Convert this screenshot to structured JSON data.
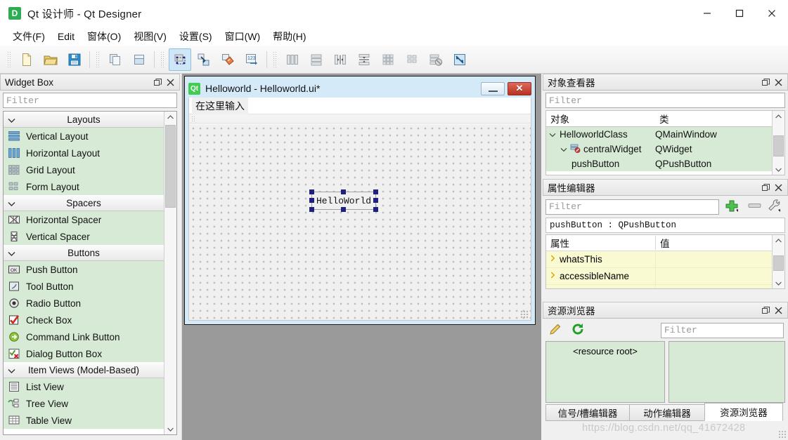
{
  "window": {
    "app_icon_letter": "D",
    "title": "Qt 设计师 - Qt Designer",
    "controls": {
      "minimize": "minimize-icon",
      "maximize": "maximize-icon",
      "close": "close-icon"
    }
  },
  "menubar": {
    "items": [
      {
        "label": "文件(F)",
        "name": "menu-file"
      },
      {
        "label": "Edit",
        "name": "menu-edit"
      },
      {
        "label": "窗体(O)",
        "name": "menu-form"
      },
      {
        "label": "视图(V)",
        "name": "menu-view"
      },
      {
        "label": "设置(S)",
        "name": "menu-settings"
      },
      {
        "label": "窗口(W)",
        "name": "menu-window"
      },
      {
        "label": "帮助(H)",
        "name": "menu-help"
      }
    ]
  },
  "toolbar": {
    "groups": [
      {
        "buttons": [
          {
            "name": "new-form-button",
            "icon": "new-file-icon",
            "active": false
          },
          {
            "name": "open-form-button",
            "icon": "open-folder-icon",
            "active": false
          },
          {
            "name": "save-form-button",
            "icon": "save-disk-icon",
            "active": false
          }
        ]
      },
      {
        "buttons": [
          {
            "name": "copy-button",
            "icon": "copy-icon",
            "active": false
          },
          {
            "name": "paste-button",
            "icon": "paste-icon",
            "active": false
          }
        ]
      },
      {
        "buttons": [
          {
            "name": "edit-widgets-button",
            "icon": "edit-widgets-icon",
            "active": true
          },
          {
            "name": "edit-signals-slots-button",
            "icon": "signals-slots-icon",
            "active": false
          },
          {
            "name": "edit-buddies-button",
            "icon": "buddies-icon",
            "active": false
          },
          {
            "name": "edit-tab-order-button",
            "icon": "tab-order-icon",
            "active": false
          }
        ]
      },
      {
        "buttons": [
          {
            "name": "layout-horizontally-button",
            "icon": "layout-horizontal-icon",
            "active": false
          },
          {
            "name": "layout-vertically-button",
            "icon": "layout-vertical-icon",
            "active": false
          },
          {
            "name": "layout-splitter-horizontal-button",
            "icon": "splitter-horizontal-icon",
            "active": false
          },
          {
            "name": "layout-splitter-vertical-button",
            "icon": "splitter-vertical-icon",
            "active": false
          },
          {
            "name": "layout-grid-button",
            "icon": "layout-grid-icon",
            "active": false
          },
          {
            "name": "layout-form-button",
            "icon": "layout-form-icon",
            "active": false
          },
          {
            "name": "break-layout-button",
            "icon": "break-layout-icon",
            "active": false
          },
          {
            "name": "adjust-size-button",
            "icon": "adjust-size-icon",
            "active": false
          }
        ]
      }
    ]
  },
  "widget_box": {
    "title": "Widget Box",
    "filter_placeholder": "Filter",
    "categories": [
      {
        "label": "Layouts",
        "expanded": true,
        "items": [
          {
            "label": "Vertical Layout",
            "icon": "vertical-layout-icon"
          },
          {
            "label": "Horizontal Layout",
            "icon": "horizontal-layout-icon"
          },
          {
            "label": "Grid Layout",
            "icon": "grid-layout-icon"
          },
          {
            "label": "Form Layout",
            "icon": "form-layout-icon"
          }
        ]
      },
      {
        "label": "Spacers",
        "expanded": true,
        "items": [
          {
            "label": "Horizontal Spacer",
            "icon": "horizontal-spacer-icon"
          },
          {
            "label": "Vertical Spacer",
            "icon": "vertical-spacer-icon"
          }
        ]
      },
      {
        "label": "Buttons",
        "expanded": true,
        "items": [
          {
            "label": "Push Button",
            "icon": "push-button-icon"
          },
          {
            "label": "Tool Button",
            "icon": "tool-button-icon"
          },
          {
            "label": "Radio Button",
            "icon": "radio-button-icon"
          },
          {
            "label": "Check Box",
            "icon": "check-box-icon"
          },
          {
            "label": "Command Link Button",
            "icon": "command-link-icon"
          },
          {
            "label": "Dialog Button Box",
            "icon": "dialog-button-box-icon"
          }
        ]
      },
      {
        "label": "Item Views (Model-Based)",
        "expanded": true,
        "items": [
          {
            "label": "List View",
            "icon": "list-view-icon"
          },
          {
            "label": "Tree View",
            "icon": "tree-view-icon"
          },
          {
            "label": "Table View",
            "icon": "table-view-icon"
          }
        ]
      }
    ]
  },
  "form_window": {
    "title": "Helloworld - Helloworld.ui*",
    "qt_icon_label": "Qt",
    "menu_placeholder": "在这里输入",
    "selected_widget_text": "HelloWorld",
    "minimize_label": "minimize-icon",
    "close_label": "close-icon"
  },
  "object_inspector": {
    "title": "对象查看器",
    "filter_placeholder": "Filter",
    "columns": [
      "对象",
      "类"
    ],
    "rows": [
      {
        "object": "HelloworldClass",
        "class": "QMainWindow",
        "depth": 0,
        "icon": "",
        "expanded": true
      },
      {
        "object": "centralWidget",
        "class": "QWidget",
        "depth": 1,
        "icon": "central-widget-icon",
        "expanded": true
      },
      {
        "object": "pushButton",
        "class": "QPushButton",
        "depth": 2,
        "icon": "push-button-icon",
        "expanded": false
      }
    ]
  },
  "property_editor": {
    "title": "属性编辑器",
    "filter_placeholder": "Filter",
    "add_button": "add-icon",
    "remove_button": "remove-icon",
    "configure_button": "wrench-icon",
    "selected_object": "pushButton : QPushButton",
    "columns": [
      "属性",
      "值"
    ],
    "rows": [
      {
        "property": "whatsThis",
        "value": ""
      },
      {
        "property": "accessibleName",
        "value": ""
      }
    ]
  },
  "resource_browser": {
    "title": "资源浏览器",
    "edit_button": "pencil-icon",
    "reload_button": "reload-icon",
    "filter_placeholder": "Filter",
    "root_label": "<resource root>",
    "tabs": [
      {
        "label": "信号/槽编辑器",
        "active": false
      },
      {
        "label": "动作编辑器",
        "active": false
      },
      {
        "label": "资源浏览器",
        "active": true
      }
    ]
  },
  "watermark": {
    "text": "https://blog.csdn.net/qq_41672428"
  }
}
